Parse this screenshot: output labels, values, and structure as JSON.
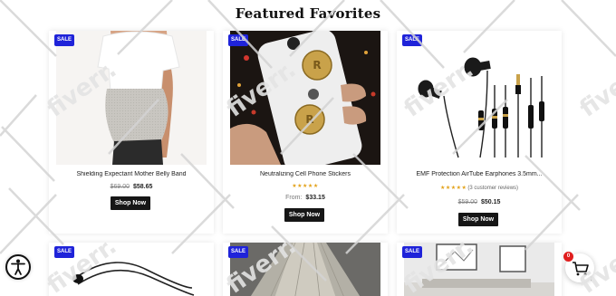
{
  "section": {
    "title": "Featured Favorites"
  },
  "sale_badge": "SALE",
  "products": [
    {
      "name": "Shielding Expectant Mother Belly Band",
      "old_price": "$69.00",
      "price": "$58.65",
      "button": "Shop Now"
    },
    {
      "name": "Neutralizing Cell Phone Stickers",
      "stars": "★★★★★",
      "from_label": "From:",
      "price": "$33.15",
      "button": "Shop Now"
    },
    {
      "name": "EMF Protection AirTube Earphones 3.5mm...",
      "stars": "★★★★★",
      "reviews": "(3 customer reviews)",
      "old_price": "$59.00",
      "price": "$50.15",
      "button": "Shop Now"
    }
  ],
  "bottom_row": [
    {
      "badge": "SALE"
    },
    {
      "badge": "SALE"
    },
    {
      "badge": "SALE"
    }
  ],
  "cart": {
    "count": "0",
    "icon": "cart-icon"
  },
  "accessibility": {
    "icon": "accessibility-icon"
  },
  "watermark": {
    "text": "fiverr."
  },
  "colors": {
    "badge": "#1f23d9",
    "button": "#161616",
    "stars": "#e3a21a",
    "cart_count": "#e01e1e"
  }
}
